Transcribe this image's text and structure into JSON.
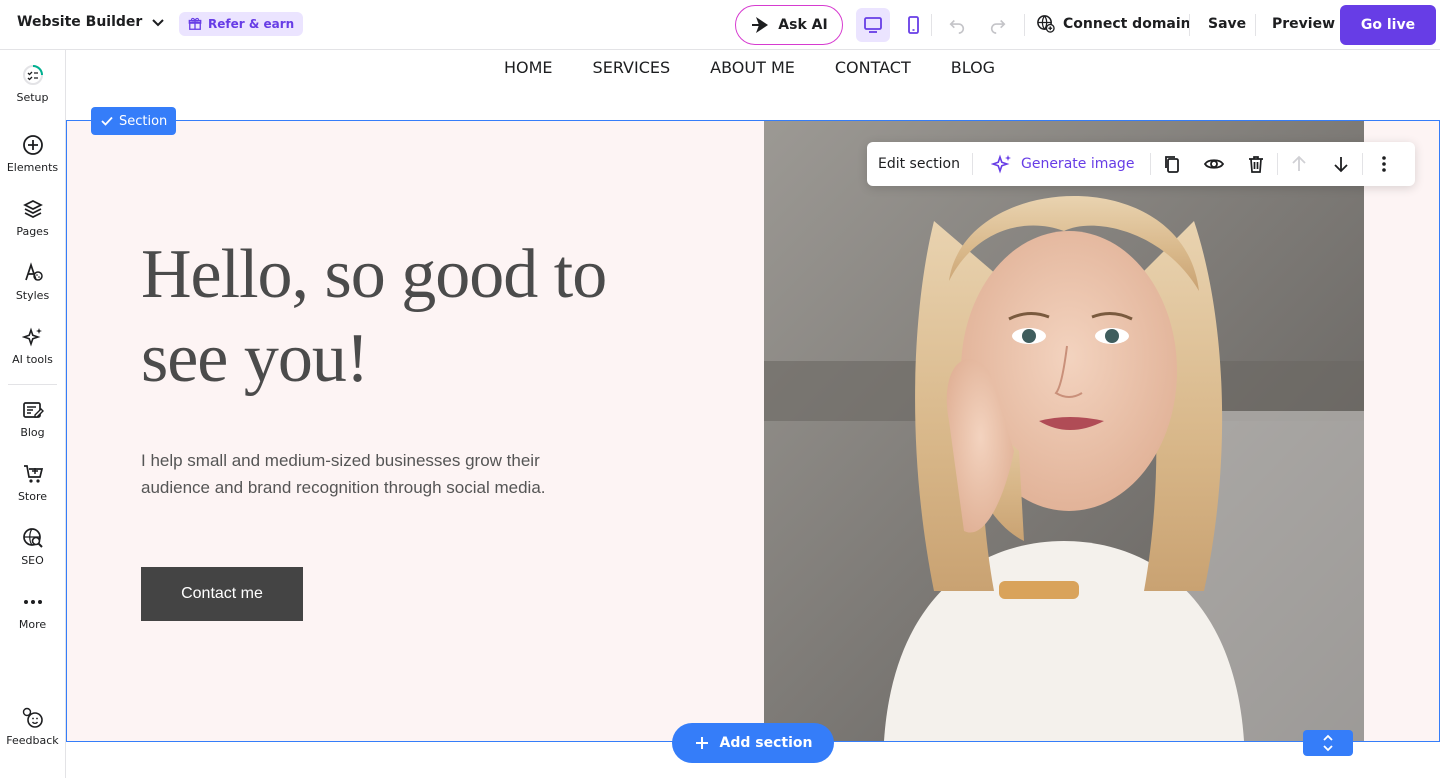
{
  "topbar": {
    "brand": "Website Builder",
    "refer": "Refer & earn",
    "ask_ai": "Ask AI",
    "connect_domain": "Connect domain",
    "save": "Save",
    "preview": "Preview",
    "go_live": "Go live"
  },
  "sidebar": {
    "items": [
      {
        "label": "Setup",
        "icon": "checklist-icon"
      },
      {
        "label": "Elements",
        "icon": "plus-circle-icon"
      },
      {
        "label": "Pages",
        "icon": "layers-icon"
      },
      {
        "label": "Styles",
        "icon": "palette-icon"
      },
      {
        "label": "AI tools",
        "icon": "sparkle-icon"
      },
      {
        "label": "Blog",
        "icon": "blog-icon"
      },
      {
        "label": "Store",
        "icon": "cart-icon"
      },
      {
        "label": "SEO",
        "icon": "seo-icon"
      },
      {
        "label": "More",
        "icon": "more-icon"
      },
      {
        "label": "Feedback",
        "icon": "feedback-icon"
      }
    ]
  },
  "site_nav": [
    "HOME",
    "SERVICES",
    "ABOUT ME",
    "CONTACT",
    "BLOG"
  ],
  "section": {
    "badge": "Section",
    "title": "Hello, so good to see you!",
    "text": "I help small and medium-sized businesses grow their audience and brand recognition through social media.",
    "button": "Contact me"
  },
  "edit_toolbar": {
    "edit_label": "Edit section",
    "generate_label": "Generate image"
  },
  "add_section": "Add section",
  "colors": {
    "accent": "#673de6",
    "selection": "#357df9",
    "section_bg": "#fdf4f4",
    "button_dark": "#444444"
  }
}
